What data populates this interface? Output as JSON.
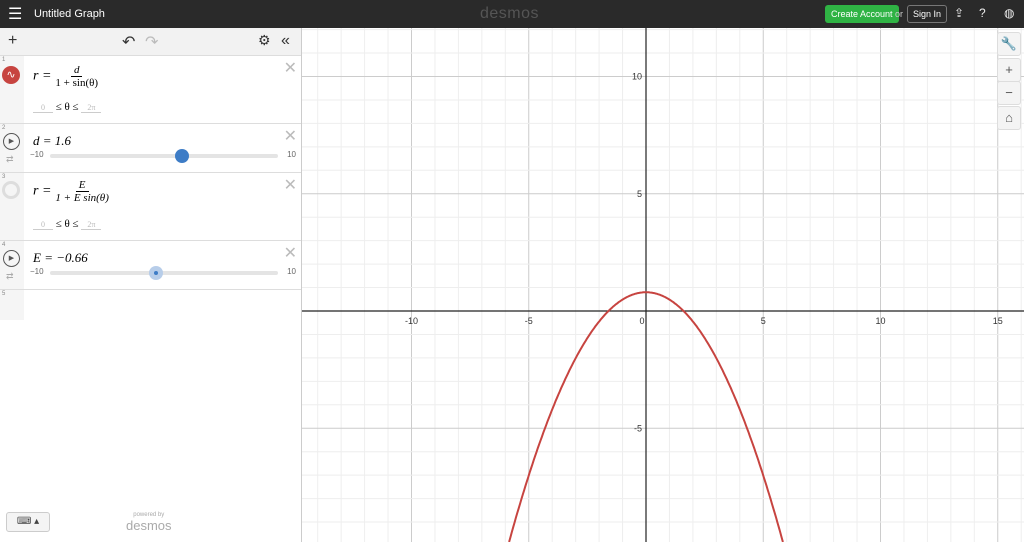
{
  "header": {
    "title": "Untitled Graph",
    "logo": "desmos",
    "create_account": "Create Account",
    "or": "or",
    "sign_in": "Sign In"
  },
  "expressions": [
    {
      "num": "1",
      "lhs": "r =",
      "numer": "d",
      "denom": "1 + sin(θ)",
      "dom_min": "0",
      "dom_mid": "≤ θ ≤",
      "dom_max": "2π",
      "color": "#c74440",
      "visible": true
    },
    {
      "num": "2",
      "label": "d = 1.6",
      "min": "−10",
      "max": "10",
      "value": 1.6
    },
    {
      "num": "3",
      "lhs": "r =",
      "numer": "E",
      "denom": "1 + E sin(θ)",
      "dom_min": "0",
      "dom_mid": "≤ θ ≤",
      "dom_max": "2π",
      "visible": false
    },
    {
      "num": "4",
      "label": "E = −0.66",
      "min": "−10",
      "max": "10",
      "value": -0.66
    },
    {
      "num": "5"
    }
  ],
  "powered": {
    "by": "powered by",
    "brand": "desmos"
  },
  "graph": {
    "xticks": [
      "-10",
      "-5",
      "0",
      "5",
      "10",
      "15"
    ],
    "yticks": [
      "10",
      "5",
      "-5"
    ],
    "xtick_vals": [
      -10,
      -5,
      0,
      5,
      10,
      15
    ],
    "ytick_vals": [
      10,
      5,
      -5
    ],
    "curve_color": "#c74440"
  }
}
